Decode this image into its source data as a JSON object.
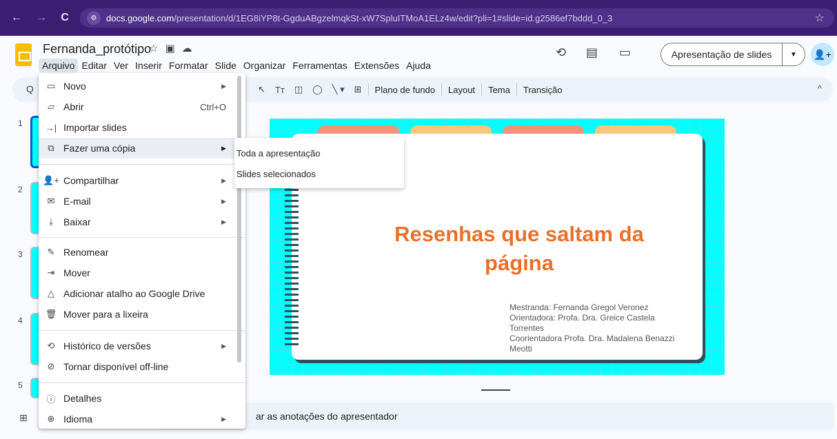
{
  "browser": {
    "url_domain": "docs.google.com",
    "url_path": "/presentation/d/1EG8iYP8t-GgduABgzelmqkSt-xW7SpluITMoA1ELz4w/edit?pli=1#slide=id.g2586ef7bddd_0_3",
    "back_icon": "←",
    "forward_icon": "→",
    "reload_icon": "C",
    "site_icon": "⚙",
    "bookmark_icon": "☆"
  },
  "header": {
    "title": "Fernanda_protótipo",
    "star_icon": "☆",
    "move_icon": "▣",
    "cloud_icon": "☁",
    "history_icon": "⟲",
    "comments_icon": "▤",
    "meet_icon": "▭",
    "present_label": "Apresentação de slides",
    "present_drop": "▼",
    "share_icon": "👤+",
    "menus": [
      "Arquivo",
      "Editar",
      "Ver",
      "Inserir",
      "Formatar",
      "Slide",
      "Organizar",
      "Ferramentas",
      "Extensões",
      "Ajuda"
    ]
  },
  "toolbar": {
    "search_icon": "Q",
    "select_icon": "↖",
    "textbox_icon": "Tт",
    "image_icon": "◫",
    "shape_icon": "◯",
    "line_icon": "╲ ▾",
    "comment_icon": "⊞",
    "background": "Plano de fundo",
    "layout": "Layout",
    "theme": "Tema",
    "transition": "Transição",
    "collapse_icon": "^"
  },
  "filmstrip": {
    "slides": [
      "1",
      "2",
      "3",
      "4",
      "5"
    ]
  },
  "file_menu": {
    "items": [
      {
        "icon": "▭",
        "label": "Novo",
        "shortcut": "",
        "arrow": "▶"
      },
      {
        "icon": "▱",
        "label": "Abrir",
        "shortcut": "Ctrl+O",
        "arrow": ""
      },
      {
        "icon": "→|",
        "label": "Importar slides",
        "shortcut": "",
        "arrow": ""
      },
      {
        "icon": "⧉",
        "label": "Fazer uma cópia",
        "shortcut": "",
        "arrow": "▶"
      },
      {
        "icon": "👤+",
        "label": "Compartilhar",
        "shortcut": "",
        "arrow": "▶"
      },
      {
        "icon": "✉",
        "label": "E-mail",
        "shortcut": "",
        "arrow": "▶"
      },
      {
        "icon": "⤓",
        "label": "Baixar",
        "shortcut": "",
        "arrow": "▶"
      },
      {
        "icon": "✎",
        "label": "Renomear",
        "shortcut": "",
        "arrow": ""
      },
      {
        "icon": "⇥",
        "label": "Mover",
        "shortcut": "",
        "arrow": ""
      },
      {
        "icon": "△",
        "label": "Adicionar atalho ao Google Drive",
        "shortcut": "",
        "arrow": ""
      },
      {
        "icon": "🗑",
        "label": "Mover para a lixeira",
        "shortcut": "",
        "arrow": ""
      },
      {
        "icon": "⟲",
        "label": "Histórico de versões",
        "shortcut": "",
        "arrow": "▶"
      },
      {
        "icon": "⊘",
        "label": "Tornar disponível off-line",
        "shortcut": "",
        "arrow": ""
      },
      {
        "icon": "ⓘ",
        "label": "Detalhes",
        "shortcut": "",
        "arrow": ""
      },
      {
        "icon": "⊕",
        "label": "Idioma",
        "shortcut": "",
        "arrow": "▶"
      }
    ]
  },
  "copy_submenu": {
    "items": [
      "Toda a apresentação",
      "Slides selecionados"
    ]
  },
  "slide": {
    "title": "Resenhas que saltam da página",
    "credits": [
      "Mestranda: Fernanda Gregol Veronez",
      "Orientadora: Profa. Dra. Greice Castela",
      "Torrentes",
      "Coorientadora Profa. Dra. Madalena Benazzi",
      "Meotti"
    ]
  },
  "notes": {
    "text": "ar as anotações do apresentador",
    "grid_icon": "⊞"
  },
  "colors": {
    "browser_bar": "#3c1f73",
    "slide_bg": "#00ffff",
    "title_orange": "#e8702a",
    "tab_colors": [
      "#f4927a",
      "#f7c77a",
      "#f4927a",
      "#f7c77a"
    ],
    "accent_blue": "#0b57d0"
  }
}
